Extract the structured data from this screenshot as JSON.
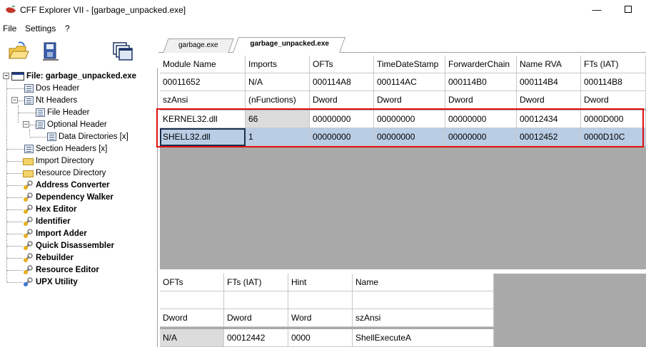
{
  "window": {
    "title": "CFF Explorer VII - [garbage_unpacked.exe]",
    "minimize_glyph": "—",
    "maximize_glyph": "☐"
  },
  "menu": [
    "File",
    "Settings",
    "?"
  ],
  "toolbar": {
    "icons": [
      "open-file-icon",
      "save-file-icon",
      "windows-icon"
    ]
  },
  "tree": {
    "root": "File: garbage_unpacked.exe",
    "items": [
      {
        "label": "Dos Header",
        "icon": "page-icon",
        "level": 1,
        "bold": false
      },
      {
        "label": "Nt Headers",
        "icon": "page-icon",
        "level": 1,
        "bold": false,
        "expander": "−"
      },
      {
        "label": "File Header",
        "icon": "page-icon",
        "level": 2,
        "bold": false
      },
      {
        "label": "Optional Header",
        "icon": "page-icon",
        "level": 2,
        "bold": false,
        "expander": "−"
      },
      {
        "label": "Data Directories [x]",
        "icon": "page-icon",
        "level": 3,
        "bold": false
      },
      {
        "label": "Section Headers [x]",
        "icon": "page-icon",
        "level": 1,
        "bold": false
      },
      {
        "label": "Import Directory",
        "icon": "folder-icon",
        "level": 1,
        "bold": false
      },
      {
        "label": "Resource Directory",
        "icon": "folder-icon",
        "level": 1,
        "bold": false
      },
      {
        "label": "Address Converter",
        "icon": "tool-icon",
        "level": 1,
        "bold": true
      },
      {
        "label": "Dependency Walker",
        "icon": "tool-icon",
        "level": 1,
        "bold": true
      },
      {
        "label": "Hex Editor",
        "icon": "tool-icon",
        "level": 1,
        "bold": true
      },
      {
        "label": "Identifier",
        "icon": "tool-icon",
        "level": 1,
        "bold": true
      },
      {
        "label": "Import Adder",
        "icon": "tool-icon",
        "level": 1,
        "bold": true
      },
      {
        "label": "Quick Disassembler",
        "icon": "tool-icon",
        "level": 1,
        "bold": true
      },
      {
        "label": "Rebuilder",
        "icon": "tool-icon",
        "level": 1,
        "bold": true
      },
      {
        "label": "Resource Editor",
        "icon": "tool-icon",
        "level": 1,
        "bold": true
      },
      {
        "label": "UPX Utility",
        "icon": "tool-icon",
        "level": 1,
        "bold": true
      }
    ]
  },
  "tabs": [
    {
      "label": "garbage.exe",
      "active": false
    },
    {
      "label": "garbage_unpacked.exe",
      "active": true
    }
  ],
  "imports_table": {
    "headers": [
      "Module Name",
      "Imports",
      "OFTs",
      "TimeDateStamp",
      "ForwarderChain",
      "Name RVA",
      "FTs (IAT)"
    ],
    "offsets_row": [
      "00011652",
      "N/A",
      "000114A8",
      "000114AC",
      "000114B0",
      "000114B4",
      "000114B8"
    ],
    "types_row": [
      "szAnsi",
      "(nFunctions)",
      "Dword",
      "Dword",
      "Dword",
      "Dword",
      "Dword"
    ],
    "rows": [
      [
        "KERNEL32.dll",
        "66",
        "00000000",
        "00000000",
        "00000000",
        "00012434",
        "0000D000"
      ],
      [
        "SHELL32.dll",
        "1",
        "00000000",
        "00000000",
        "00000000",
        "00012452",
        "0000D10C"
      ]
    ],
    "selected_row": 1,
    "highlight_color": "#e01010"
  },
  "functions_table": {
    "headers": [
      "OFTs",
      "FTs (IAT)",
      "Hint",
      "Name"
    ],
    "blank_row": [
      "",
      "",
      "",
      ""
    ],
    "types_row": [
      "Dword",
      "Dword",
      "Word",
      "szAnsi"
    ],
    "rows": [
      [
        "N/A",
        "00012442",
        "0000",
        "ShellExecuteA"
      ]
    ]
  }
}
